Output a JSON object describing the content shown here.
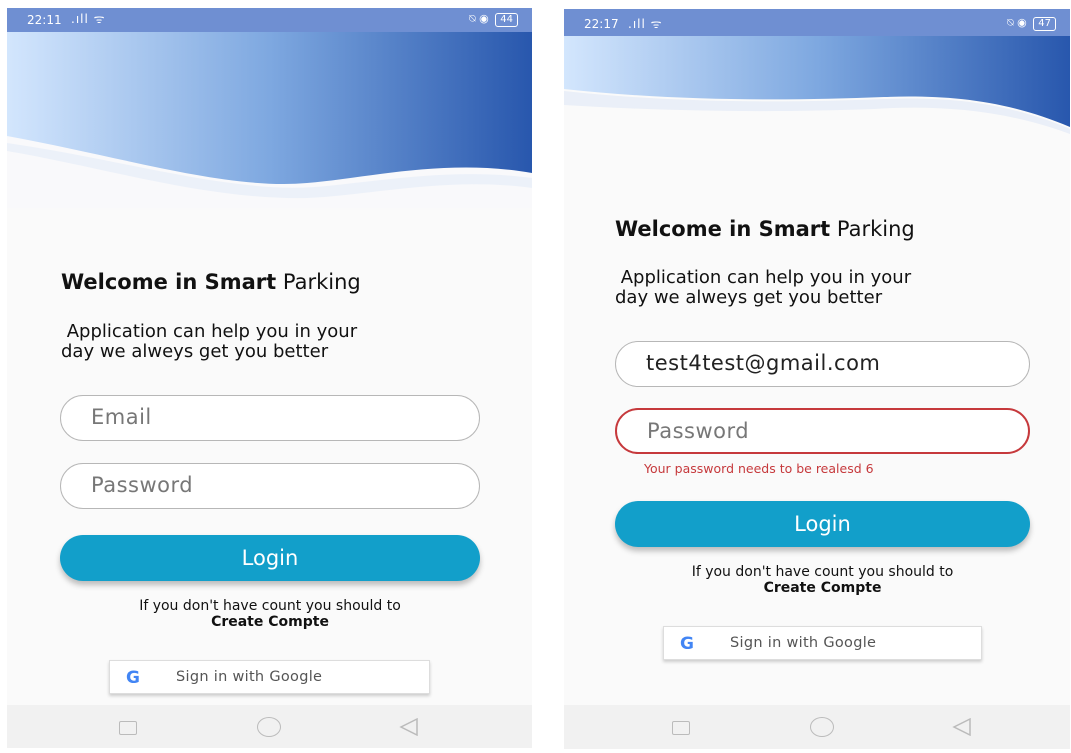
{
  "left": {
    "status": {
      "time": "22:11",
      "signal": ".ıll ᯤ",
      "icons": "⍉ ◉",
      "battery": "44"
    },
    "title_bold": "Welcome in Smart",
    "title_light": "Parking",
    "subtitle_line1": " Application can help you in your",
    "subtitle_line2": "day we alweys get you better",
    "email_placeholder": "Email",
    "password_placeholder": "Password",
    "login_label": "Login",
    "hint_text": "If you don't have count you should to",
    "create_label": "Create Compte",
    "google_label": "Sign in with Google",
    "google_icon": "google-icon"
  },
  "right": {
    "status": {
      "time": "22:17",
      "signal": ".ıll ᯤ",
      "icons": "⍉ ◉",
      "battery": "47"
    },
    "title_bold": "Welcome in Smart",
    "title_light": "Parking",
    "subtitle_line1": " Application can help you in your",
    "subtitle_line2": "day we alweys get you better",
    "email_value": "test4test@gmail.com",
    "password_placeholder": "Password",
    "password_error": "Your password needs to be realesd 6",
    "login_label": "Login",
    "hint_text": "If you don't have count you should to",
    "create_label": "Create Compte",
    "google_label": "Sign in with Google",
    "google_icon": "google-icon"
  },
  "colors": {
    "primary": "#129fca",
    "error": "#c6393c",
    "header_dark": "#2a5bb0",
    "header_light": "#cfe3fb"
  }
}
